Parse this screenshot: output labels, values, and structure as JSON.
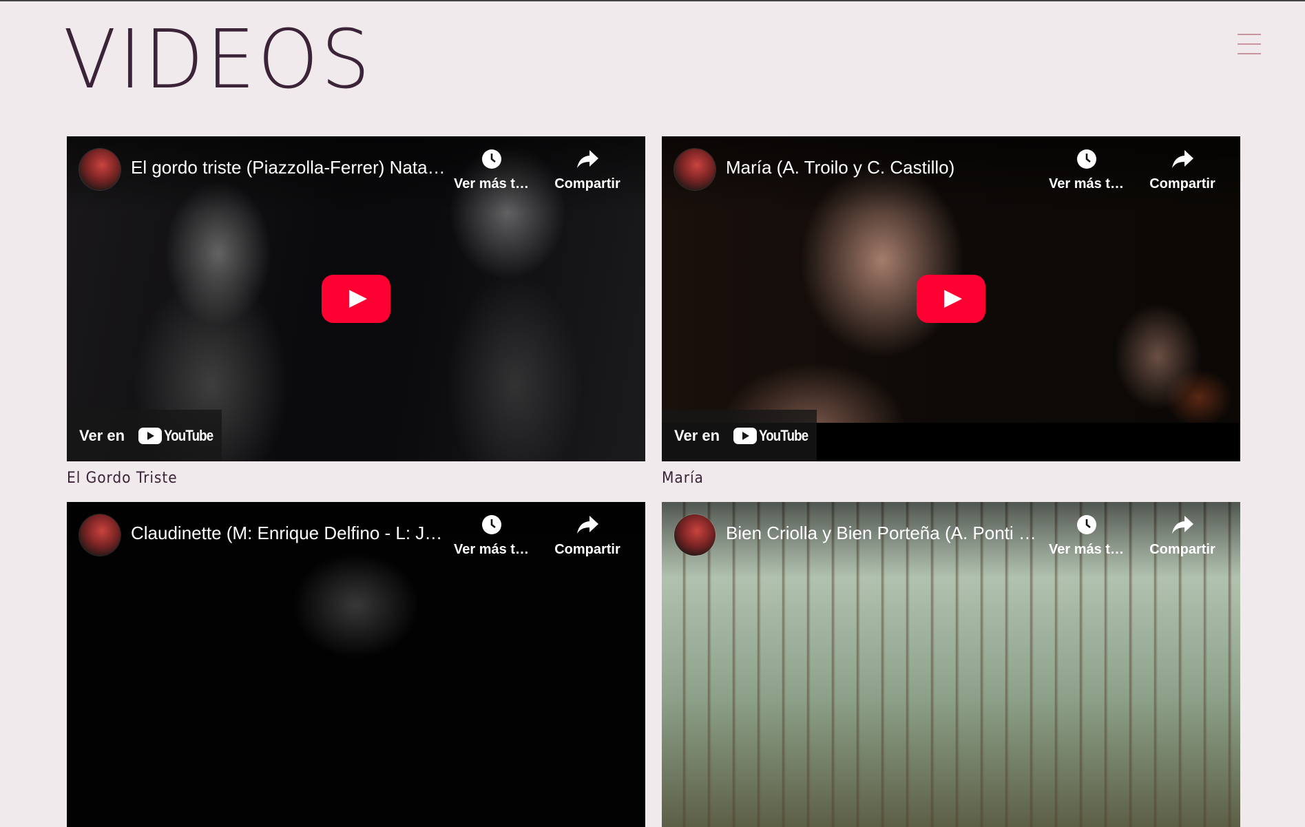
{
  "page": {
    "title": "VIDEOS"
  },
  "menu": {
    "icon": "hamburger-menu-icon"
  },
  "player_labels": {
    "watch_later": "Ver más tarde",
    "share": "Compartir",
    "watch_on": "Ver en",
    "youtube": "YouTube"
  },
  "videos": [
    {
      "title": "El gordo triste (Piazzolla-Ferrer) Natalia Bazán",
      "caption": "El Gordo Triste"
    },
    {
      "title": "María (A. Troilo y C. Castillo)",
      "caption": "María"
    },
    {
      "title": "Claudinette (M: Enrique Delfino - L: Julián Centeya)",
      "caption": ""
    },
    {
      "title": "Bien Criolla y Bien Porteña (A. Ponti y R. Caló)",
      "caption": ""
    }
  ],
  "colors": {
    "background": "#f1eaec",
    "title": "#3b2338",
    "menu": "#c9969f",
    "play": "#ff0033"
  }
}
